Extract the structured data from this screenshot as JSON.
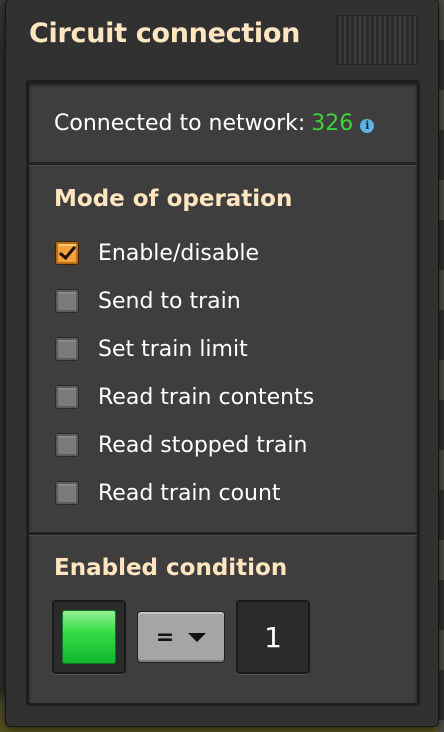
{
  "window": {
    "title": "Circuit connection"
  },
  "network": {
    "label": "Connected to network:",
    "count": "326",
    "info_icon": "info-icon",
    "count_color": "#3dd13d"
  },
  "mode": {
    "title": "Mode of operation",
    "options": [
      {
        "label": "Enable/disable",
        "checked": true
      },
      {
        "label": "Send to train",
        "checked": false
      },
      {
        "label": "Set train limit",
        "checked": false
      },
      {
        "label": "Read train contents",
        "checked": false
      },
      {
        "label": "Read stopped train",
        "checked": false
      },
      {
        "label": "Read train count",
        "checked": false
      }
    ]
  },
  "condition": {
    "title": "Enabled condition",
    "signal_icon": "green-signal-icon",
    "comparator": "=",
    "constant": "1"
  },
  "colors": {
    "heading": "#ffe6c0",
    "checkbox_checked": "#f2a33a",
    "signal_green": "#37dd47"
  }
}
